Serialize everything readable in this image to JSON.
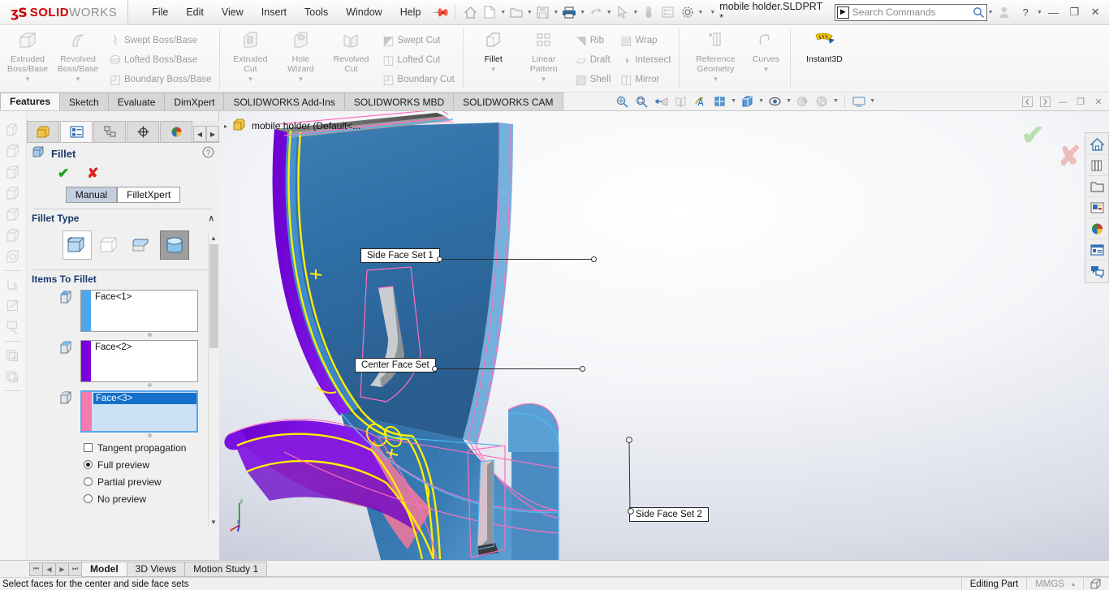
{
  "titlebar": {
    "logo_3ds": "ʒS",
    "logo_solid": "SOLID",
    "logo_works": "WORKS",
    "menus": [
      "File",
      "Edit",
      "View",
      "Insert",
      "Tools",
      "Window",
      "Help"
    ],
    "pin_icon": "pin-icon",
    "quick_access": [
      {
        "name": "home-icon",
        "glyph": "⌂"
      },
      {
        "name": "new-document-icon",
        "glyph": "□",
        "caret": true
      },
      {
        "name": "open-folder-icon",
        "glyph": "◧",
        "caret": true
      },
      {
        "name": "save-icon",
        "glyph": "▤",
        "caret": true
      },
      {
        "name": "print-icon",
        "glyph": "⎙",
        "caret": true
      },
      {
        "name": "undo-icon",
        "glyph": "↶",
        "caret": true
      },
      {
        "name": "select-cursor-icon",
        "glyph": "➤",
        "caret": true
      },
      {
        "name": "rebuild-icon",
        "glyph": "⬤"
      },
      {
        "name": "file-properties-icon",
        "glyph": "☰"
      },
      {
        "name": "options-gear-icon",
        "glyph": "⚙",
        "caret": true
      }
    ],
    "document_title": "mobile holder.SLDPRT *",
    "search_placeholder": "Search Commands",
    "search_value": "",
    "search_prefix_icon": "command-search-icon",
    "profile_icon": "user-account-icon",
    "help_label": "?",
    "window_buttons": [
      "—",
      "❐",
      "✕"
    ]
  },
  "ribbon": {
    "groups": [
      {
        "name": "boss-base",
        "big": [
          {
            "label": "Extruded\nBoss/Base",
            "icon": "extruded-boss-icon",
            "glyph": "⬛",
            "dropdown": true
          },
          {
            "label": "Revolved\nBoss/Base",
            "icon": "revolved-boss-icon",
            "glyph": "◔",
            "dropdown": true
          }
        ],
        "small": [
          {
            "label": "Swept Boss/Base",
            "icon": "swept-boss-icon",
            "glyph": "⌇"
          },
          {
            "label": "Lofted Boss/Base",
            "icon": "lofted-boss-icon",
            "glyph": "⛁"
          },
          {
            "label": "Boundary Boss/Base",
            "icon": "boundary-boss-icon",
            "glyph": "◰"
          }
        ]
      },
      {
        "name": "cut",
        "big": [
          {
            "label": "Extruded\nCut",
            "icon": "extruded-cut-icon",
            "glyph": "▣",
            "dropdown": true
          },
          {
            "label": "Hole\nWizard",
            "icon": "hole-wizard-icon",
            "glyph": "◉",
            "dropdown": true
          },
          {
            "label": "Revolved\nCut",
            "icon": "revolved-cut-icon",
            "glyph": "⊓"
          }
        ],
        "small": [
          {
            "label": "Swept Cut",
            "icon": "swept-cut-icon",
            "glyph": "◩"
          },
          {
            "label": "Lofted Cut",
            "icon": "lofted-cut-icon",
            "glyph": "◫"
          },
          {
            "label": "Boundary Cut",
            "icon": "boundary-cut-icon",
            "glyph": "◰"
          }
        ]
      },
      {
        "name": "features",
        "big": [
          {
            "label": "Fillet",
            "icon": "fillet-icon",
            "glyph": "⬜",
            "dropdown": true,
            "active": true
          },
          {
            "label": "Linear\nPattern",
            "icon": "linear-pattern-icon",
            "glyph": "∷",
            "dropdown": true
          }
        ],
        "small": [
          {
            "label": "Rib",
            "icon": "rib-icon",
            "glyph": "◥"
          },
          {
            "label": "Draft",
            "icon": "draft-icon",
            "glyph": "◱"
          },
          {
            "label": "Shell",
            "icon": "shell-icon",
            "glyph": "▧"
          }
        ],
        "small2": [
          {
            "label": "Wrap",
            "icon": "wrap-icon",
            "glyph": "▤"
          },
          {
            "label": "Intersect",
            "icon": "intersect-icon",
            "glyph": "◑"
          },
          {
            "label": "Mirror",
            "icon": "mirror-icon",
            "glyph": "◫"
          }
        ]
      },
      {
        "name": "reference",
        "big": [
          {
            "label": "Reference\nGeometry",
            "icon": "reference-geometry-icon",
            "glyph": "⧉",
            "dropdown": true
          },
          {
            "label": "Curves",
            "icon": "curves-icon",
            "glyph": "∿",
            "dropdown": true
          }
        ],
        "small": []
      },
      {
        "name": "instant3d",
        "big": [
          {
            "label": "Instant3D",
            "icon": "instant3d-icon",
            "glyph": "➤",
            "active": true
          }
        ],
        "small": []
      }
    ]
  },
  "command_tabs": {
    "items": [
      "Features",
      "Sketch",
      "Evaluate",
      "DimXpert",
      "SOLIDWORKS Add-Ins",
      "SOLIDWORKS MBD",
      "SOLIDWORKS CAM"
    ],
    "selected": "Features"
  },
  "view_toolbar": [
    {
      "name": "zoom-to-fit-icon",
      "glyph": "⌕"
    },
    {
      "name": "zoom-to-area-icon",
      "glyph": "⌕"
    },
    {
      "name": "previous-view-icon",
      "glyph": "⬅"
    },
    {
      "name": "section-view-icon",
      "glyph": "◫"
    },
    {
      "name": "view-orientation-icon",
      "glyph": "⚡"
    },
    {
      "name": "view-orientation-cube-icon",
      "glyph": "◰",
      "caret": true
    },
    {
      "name": "display-style-icon",
      "glyph": "⬛",
      "caret": true
    },
    {
      "name": "hide-show-items-icon",
      "glyph": "◑",
      "caret": true
    },
    {
      "name": "edit-appearance-icon",
      "glyph": "●",
      "caret": true
    },
    {
      "name": "apply-scene-icon",
      "glyph": "◕",
      "caret": true
    },
    {
      "name": "view-settings-icon",
      "glyph": "▭",
      "caret": true
    }
  ],
  "window_controls_inner": [
    "◁",
    "▷",
    "—",
    "❐",
    "✕"
  ],
  "left_rail": [
    {
      "name": "rail-icon-1",
      "glyph": "◱"
    },
    {
      "name": "rail-icon-2",
      "glyph": "▢"
    },
    {
      "name": "rail-icon-3",
      "glyph": "▢"
    },
    {
      "name": "rail-icon-4",
      "glyph": "▢"
    },
    {
      "name": "rail-icon-5",
      "glyph": "▢"
    },
    {
      "name": "rail-icon-6",
      "glyph": "▢"
    },
    {
      "name": "rail-icon-7",
      "glyph": "⬠"
    },
    {
      "sep": true
    },
    {
      "name": "rail-icon-8",
      "glyph": "✎"
    },
    {
      "name": "rail-icon-9",
      "glyph": "⚒"
    },
    {
      "name": "rail-icon-10",
      "glyph": "⎙"
    },
    {
      "sep": true
    },
    {
      "name": "rail-icon-11",
      "glyph": "⧉"
    },
    {
      "name": "rail-icon-12",
      "glyph": "⧉"
    },
    {
      "sep": true
    }
  ],
  "property_manager": {
    "tabs": [
      {
        "name": "feature-manager-tab",
        "glyph": "⬟",
        "color": "#e8b530"
      },
      {
        "name": "property-manager-tab",
        "glyph": "☰",
        "color": "#2f6fb5",
        "selected": true
      },
      {
        "name": "configuration-manager-tab",
        "glyph": "⛓",
        "color": "#5a5a5a"
      },
      {
        "name": "dimxpert-manager-tab",
        "glyph": "⊕",
        "color": "#333333"
      },
      {
        "name": "display-manager-tab",
        "glyph": "◕",
        "color": "#c03030"
      }
    ],
    "nav_prev": "◀",
    "nav_next": "▶",
    "title": "Fillet",
    "title_icon": "fillet-feature-icon",
    "help_icon": "help-question-icon",
    "ok_icon": "✔",
    "cancel_icon": "✘",
    "mode_toggle": {
      "options": [
        "Manual",
        "FilletXpert"
      ],
      "selected": "Manual"
    },
    "sections": {
      "fillet_type": {
        "label": "Fillet Type",
        "chevron": "∧",
        "options": [
          {
            "name": "constant-size-fillet-icon",
            "glyph": "◰",
            "state": "framed"
          },
          {
            "name": "variable-size-fillet-icon",
            "glyph": "⬜",
            "state": "normal"
          },
          {
            "name": "face-fillet-icon",
            "glyph": "◱",
            "state": "normal"
          },
          {
            "name": "full-round-fillet-icon",
            "glyph": "⛁",
            "state": "selected"
          }
        ]
      },
      "items_to_fillet": {
        "label": "Items To Fillet",
        "chevron": "∧",
        "selections": [
          {
            "icon": "side-face-set-1-icon",
            "swatch": "#4da6f0",
            "value": "Face<1>",
            "active": false
          },
          {
            "icon": "center-face-set-icon",
            "swatch": "#7b00e0",
            "value": "Face<2>",
            "active": false
          },
          {
            "icon": "side-face-set-2-icon",
            "swatch": "#f47ab0",
            "value": "Face<3>",
            "active": true
          }
        ],
        "checkbox": {
          "label": "Tangent propagation",
          "checked": false
        },
        "radios": [
          {
            "label": "Full preview",
            "checked": true
          },
          {
            "label": "Partial preview",
            "checked": false
          },
          {
            "label": "No preview",
            "checked": false
          }
        ]
      }
    }
  },
  "feature_tree": {
    "expand_arrow": "▸",
    "icon": "part-icon",
    "label": "mobile holder  (Default<..."
  },
  "graphics": {
    "ghost_ok": "✔",
    "ghost_cancel": "✘",
    "callouts": [
      {
        "name": "callout-side-face-set-1",
        "label": "Side Face Set 1"
      },
      {
        "name": "callout-center-face-set",
        "label": "Center Face Set"
      },
      {
        "name": "callout-side-face-set-2",
        "label": "Side Face Set 2"
      }
    ],
    "triad": {
      "x": "x",
      "y": "y",
      "z": "z"
    },
    "model_colors": {
      "face_blue": "#2f6fa8",
      "face_blue_light": "#4f9fd4",
      "highlight_blue": "#4da6f0",
      "highlight_purple": "#7b00e0",
      "highlight_pink": "#e878ac",
      "preview_yellow": "#ffef00",
      "sketch_pink": "#ff6fbf"
    }
  },
  "right_dock": [
    {
      "name": "solidworks-resources-icon",
      "glyph": "⌂"
    },
    {
      "name": "design-library-icon",
      "glyph": "☷"
    },
    {
      "name": "file-explorer-icon",
      "glyph": "◱"
    },
    {
      "name": "view-palette-icon",
      "glyph": "▥"
    },
    {
      "name": "appearances-scenes-icon",
      "glyph": "◕"
    },
    {
      "name": "custom-properties-icon",
      "glyph": "☰"
    },
    {
      "name": "solidworks-forum-icon",
      "glyph": "⬚"
    }
  ],
  "bottom_tabs": {
    "nav_buttons": [
      "⏮",
      "◀",
      "▶",
      "⏭"
    ],
    "items": [
      "Model",
      "3D Views",
      "Motion Study 1"
    ],
    "selected": "Model"
  },
  "status_bar": {
    "message": "Select faces for the center and side face sets",
    "editing_state": "Editing Part",
    "units": "MMGS",
    "units_caret": "▴",
    "overlay_icon": "display-style-status-icon"
  }
}
